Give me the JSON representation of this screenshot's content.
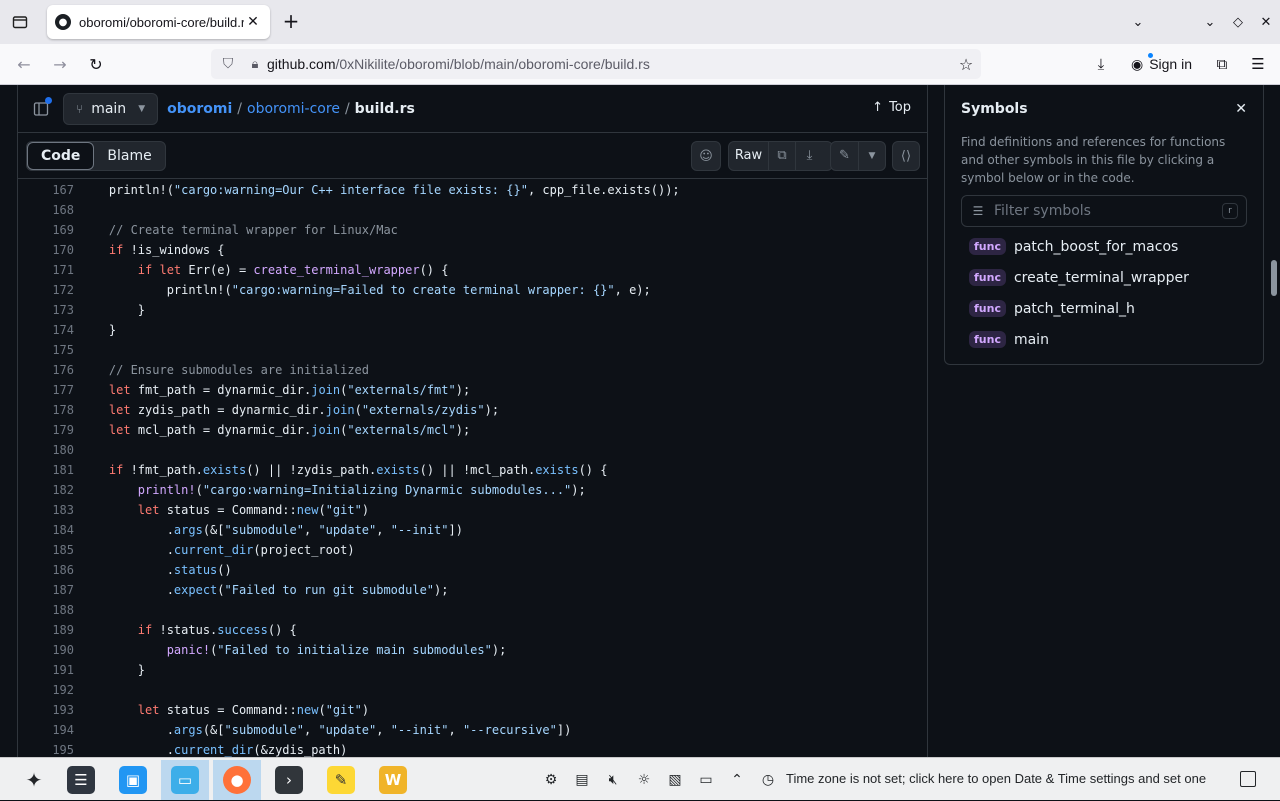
{
  "browser": {
    "tab_title": "oboromi/oboromi-core/build.rs",
    "url_host": "github.com",
    "url_path": "/0xNikilite/oboromi/blob/main/oboromi-core/build.rs",
    "sign_in": "Sign in"
  },
  "file_header": {
    "branch": "main",
    "repo": "oboromi",
    "folder": "oboromi-core",
    "file": "build.rs",
    "top": "Top"
  },
  "toolbar": {
    "code": "Code",
    "blame": "Blame",
    "raw": "Raw"
  },
  "code_lines": [
    {
      "n": "167",
      "html": "    println!(<span class=\"str\">\"cargo:warning=Our C++ interface file exists: {}\"</span>, cpp_file.exists());"
    },
    {
      "n": "168",
      "html": ""
    },
    {
      "n": "169",
      "html": "    <span class=\"cm\">// Create terminal wrapper for Linux/Mac</span>"
    },
    {
      "n": "170",
      "html": "    <span class=\"kw\">if</span> !is_windows {"
    },
    {
      "n": "171",
      "html": "        <span class=\"kw\">if let</span> Err(e) = <span class=\"fn\">create_terminal_wrapper</span>() {"
    },
    {
      "n": "172",
      "html": "            println!(<span class=\"str\">\"cargo:warning=Failed to create terminal wrapper: {}\"</span>, e);"
    },
    {
      "n": "173",
      "html": "        }"
    },
    {
      "n": "174",
      "html": "    }"
    },
    {
      "n": "175",
      "html": ""
    },
    {
      "n": "176",
      "html": "    <span class=\"cm\">// Ensure submodules are initialized</span>"
    },
    {
      "n": "177",
      "html": "    <span class=\"kw\">let</span> fmt_path = dynarmic_dir.<span class=\"mc\">join</span>(<span class=\"str\">\"externals/fmt\"</span>);"
    },
    {
      "n": "178",
      "html": "    <span class=\"kw\">let</span> zydis_path = dynarmic_dir.<span class=\"mc\">join</span>(<span class=\"str\">\"externals/zydis\"</span>);"
    },
    {
      "n": "179",
      "html": "    <span class=\"kw\">let</span> mcl_path = dynarmic_dir.<span class=\"mc\">join</span>(<span class=\"str\">\"externals/mcl\"</span>);"
    },
    {
      "n": "180",
      "html": ""
    },
    {
      "n": "181",
      "html": "    <span class=\"kw\">if</span> !fmt_path.<span class=\"mc\">exists</span>() || !zydis_path.<span class=\"mc\">exists</span>() || !mcl_path.<span class=\"mc\">exists</span>() {"
    },
    {
      "n": "182",
      "html": "        <span class=\"fn\">println!</span>(<span class=\"str\">\"cargo:warning=Initializing Dynarmic submodules...\"</span>);"
    },
    {
      "n": "183",
      "html": "        <span class=\"kw\">let</span> status = Command::<span class=\"mc\">new</span>(<span class=\"str\">\"git\"</span>)"
    },
    {
      "n": "184",
      "html": "            .<span class=\"mc\">args</span>(&amp;[<span class=\"str\">\"submodule\"</span>, <span class=\"str\">\"update\"</span>, <span class=\"str\">\"--init\"</span>])"
    },
    {
      "n": "185",
      "html": "            .<span class=\"mc\">current_dir</span>(project_root)"
    },
    {
      "n": "186",
      "html": "            .<span class=\"mc\">status</span>()"
    },
    {
      "n": "187",
      "html": "            .<span class=\"mc\">expect</span>(<span class=\"str\">\"Failed to run git submodule\"</span>);"
    },
    {
      "n": "188",
      "html": ""
    },
    {
      "n": "189",
      "html": "        <span class=\"kw\">if</span> !status.<span class=\"mc\">success</span>() {"
    },
    {
      "n": "190",
      "html": "            <span class=\"fn\">panic!</span>(<span class=\"str\">\"Failed to initialize main submodules\"</span>);"
    },
    {
      "n": "191",
      "html": "        }"
    },
    {
      "n": "192",
      "html": ""
    },
    {
      "n": "193",
      "html": "        <span class=\"kw\">let</span> status = Command::<span class=\"mc\">new</span>(<span class=\"str\">\"git\"</span>)"
    },
    {
      "n": "194",
      "html": "            .<span class=\"mc\">args</span>(&amp;[<span class=\"str\">\"submodule\"</span>, <span class=\"str\">\"update\"</span>, <span class=\"str\">\"--init\"</span>, <span class=\"str\">\"--recursive\"</span>])"
    },
    {
      "n": "195",
      "html": "            .<span class=\"mc\">current_dir</span>(&amp;zydis_path)"
    }
  ],
  "symbols": {
    "title": "Symbols",
    "description": "Find definitions and references for functions and other symbols in this file by clicking a symbol below or in the code.",
    "filter_placeholder": "Filter symbols",
    "filter_key": "r",
    "items": [
      {
        "kind": "func",
        "name": "patch_boost_for_macos"
      },
      {
        "kind": "func",
        "name": "create_terminal_wrapper"
      },
      {
        "kind": "func",
        "name": "patch_terminal_h"
      },
      {
        "kind": "func",
        "name": "main"
      }
    ]
  },
  "taskbar": {
    "status_message": "Time zone is not set; click here to open Date & Time settings and set one"
  },
  "colors": {
    "bg": "#0d1117",
    "link": "#4493f8",
    "keyword": "#ff7b72",
    "string": "#a5d6ff",
    "comment": "#8b949e",
    "function": "#d2a8ff"
  }
}
